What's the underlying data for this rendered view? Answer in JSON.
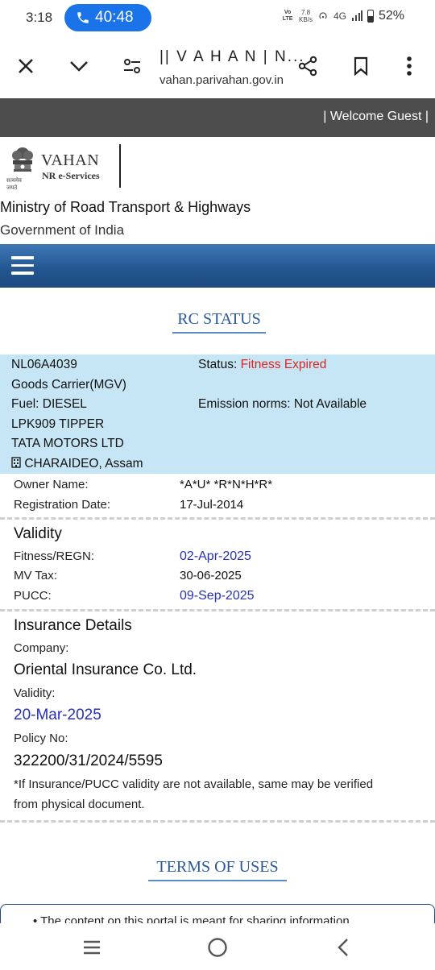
{
  "status_bar": {
    "time": "3:18",
    "call_duration": "40:48",
    "volte": "Vo LTE",
    "net_speed": "7.8",
    "net_unit": "KB/s",
    "network": "4G",
    "battery": "52%"
  },
  "browser": {
    "page_title": "|| V A H A N | N...",
    "url": "vahan.parivahan.gov.in"
  },
  "header": {
    "welcome": "| Welcome Guest |",
    "logo_title": "VAHAN",
    "logo_subtitle": "NR e-Services",
    "logo_motto": "सत्यमेव जयते",
    "ministry": "Ministry of Road Transport & Highways",
    "government": "Government of India"
  },
  "rc_status": {
    "heading": "RC STATUS",
    "reg_no": "NL06A4039",
    "status_label": "Status:",
    "status_value": "Fitness Expired",
    "vehicle_class": "Goods Carrier(MGV)",
    "fuel": "Fuel: DIESEL",
    "emission": "Emission norms: Not Available",
    "model": "LPK909 TIPPER",
    "maker": "TATA MOTORS LTD",
    "location": "CHARAIDEO, Assam",
    "owner_label": "Owner Name:",
    "owner_value": "*A*U* *R*N*H*R*",
    "reg_date_label": "Registration Date:",
    "reg_date_value": "17-Jul-2014"
  },
  "validity": {
    "heading": "Validity",
    "fitness_label": "Fitness/REGN:",
    "fitness_value": "02-Apr-2025",
    "tax_label": "MV Tax:",
    "tax_value": "30-06-2025",
    "pucc_label": "PUCC:",
    "pucc_value": "09-Sep-2025"
  },
  "insurance": {
    "heading": "Insurance Details",
    "company_label": "Company:",
    "company_value": "Oriental Insurance Co. Ltd.",
    "validity_label": "Validity:",
    "validity_value": "20-Mar-2025",
    "policy_label": "Policy No:",
    "policy_value": "322200/31/2024/5595",
    "note_line1": "*If Insurance/PUCC validity are not available, same may be verified",
    "note_line2": "from physical document."
  },
  "terms": {
    "heading": "TERMS OF USES",
    "text": "• The content on this portal is meant for sharing information"
  },
  "colors": {
    "menu_blue": "#23558f",
    "status_red": "#e0231f",
    "date_blue": "#2731b8",
    "vehicle_box": "#c6e6f5",
    "call_pill": "#1a73e8"
  }
}
